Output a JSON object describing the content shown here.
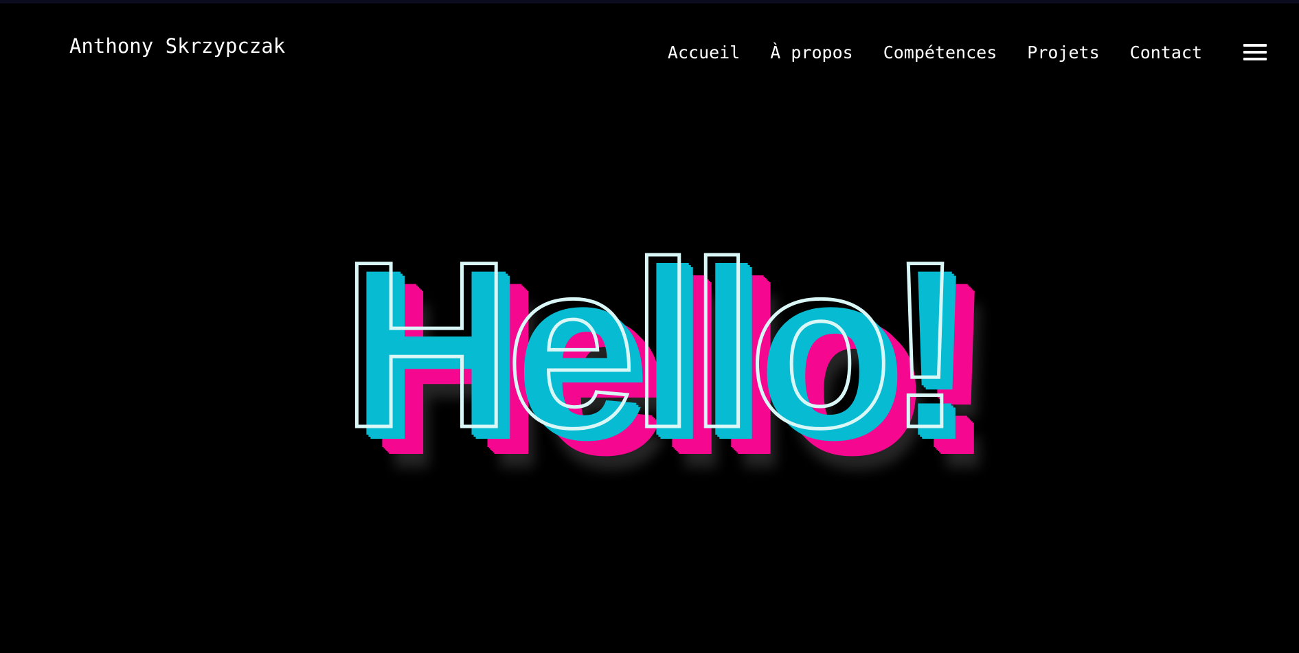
{
  "brand": {
    "name": "Anthony Skrzypczak"
  },
  "nav": {
    "links": [
      {
        "label": "Accueil"
      },
      {
        "label": "À propos"
      },
      {
        "label": "Compétences"
      },
      {
        "label": "Projets"
      },
      {
        "label": "Contact"
      }
    ],
    "menu_icon": "hamburger-menu-icon"
  },
  "hero": {
    "text": "Hello!"
  },
  "colors": {
    "background": "#000000",
    "text": "#ffffff",
    "hero_cyan": "#07bbd2",
    "hero_magenta": "#f5078f",
    "hero_outline": "#d9f7f7"
  }
}
